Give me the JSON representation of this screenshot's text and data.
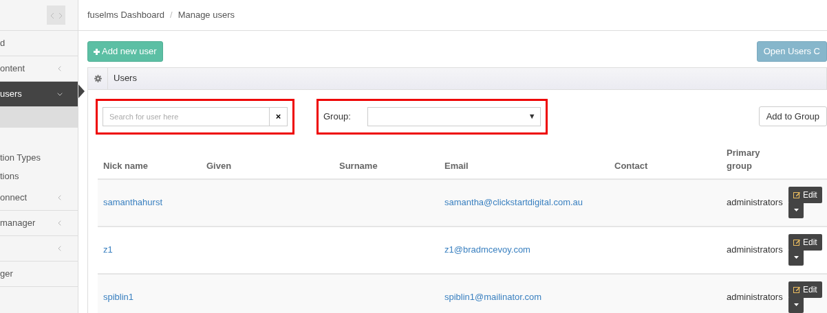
{
  "sidebar": {
    "items": [
      {
        "label": "d",
        "has_children": false,
        "selected": false
      },
      {
        "label": "ontent",
        "has_children": true,
        "selected": false
      },
      {
        "label": "users",
        "has_children": true,
        "selected": true,
        "expanded": true,
        "children": [
          {
            "kind": "blank"
          }
        ]
      },
      {
        "label": "tion Types",
        "has_children": false,
        "selected": false,
        "kind": "sub"
      },
      {
        "label": "tions",
        "has_children": false,
        "selected": false,
        "kind": "sub"
      },
      {
        "label": "onnect",
        "has_children": true,
        "selected": false
      },
      {
        "label": "manager",
        "has_children": true,
        "selected": false
      },
      {
        "has_children": true,
        "selected": false
      },
      {
        "label": "ger",
        "has_children": false,
        "selected": false
      }
    ]
  },
  "breadcrumb": [
    "fuselms Dashboard",
    "Manage users"
  ],
  "breadcrumb_separator": "/",
  "toolbar": {
    "add_button": "Add new user",
    "open_button": "Open Users C"
  },
  "panel": {
    "title": "Users",
    "search": {
      "placeholder": "Search for user here",
      "clear": "×"
    },
    "group_filter": {
      "label": "Group:",
      "caret": "▼"
    },
    "add_to_group": "Add to Group",
    "table": {
      "columns": [
        "Nick name",
        "Given",
        "Surname",
        "Email",
        "Contact",
        "Primary group"
      ],
      "rows": [
        {
          "nick": "samanthahurst",
          "email": "samantha@clickstartdigital.com.au",
          "group": "administrators",
          "edit": "Edit"
        },
        {
          "nick": "z1",
          "email": "z1@bradmcevoy.com",
          "group": "administrators",
          "edit": "Edit"
        },
        {
          "nick": "spiblin1",
          "email": "spiblin1@mailinator.com",
          "group": "administrators",
          "edit": "Edit"
        }
      ]
    }
  }
}
